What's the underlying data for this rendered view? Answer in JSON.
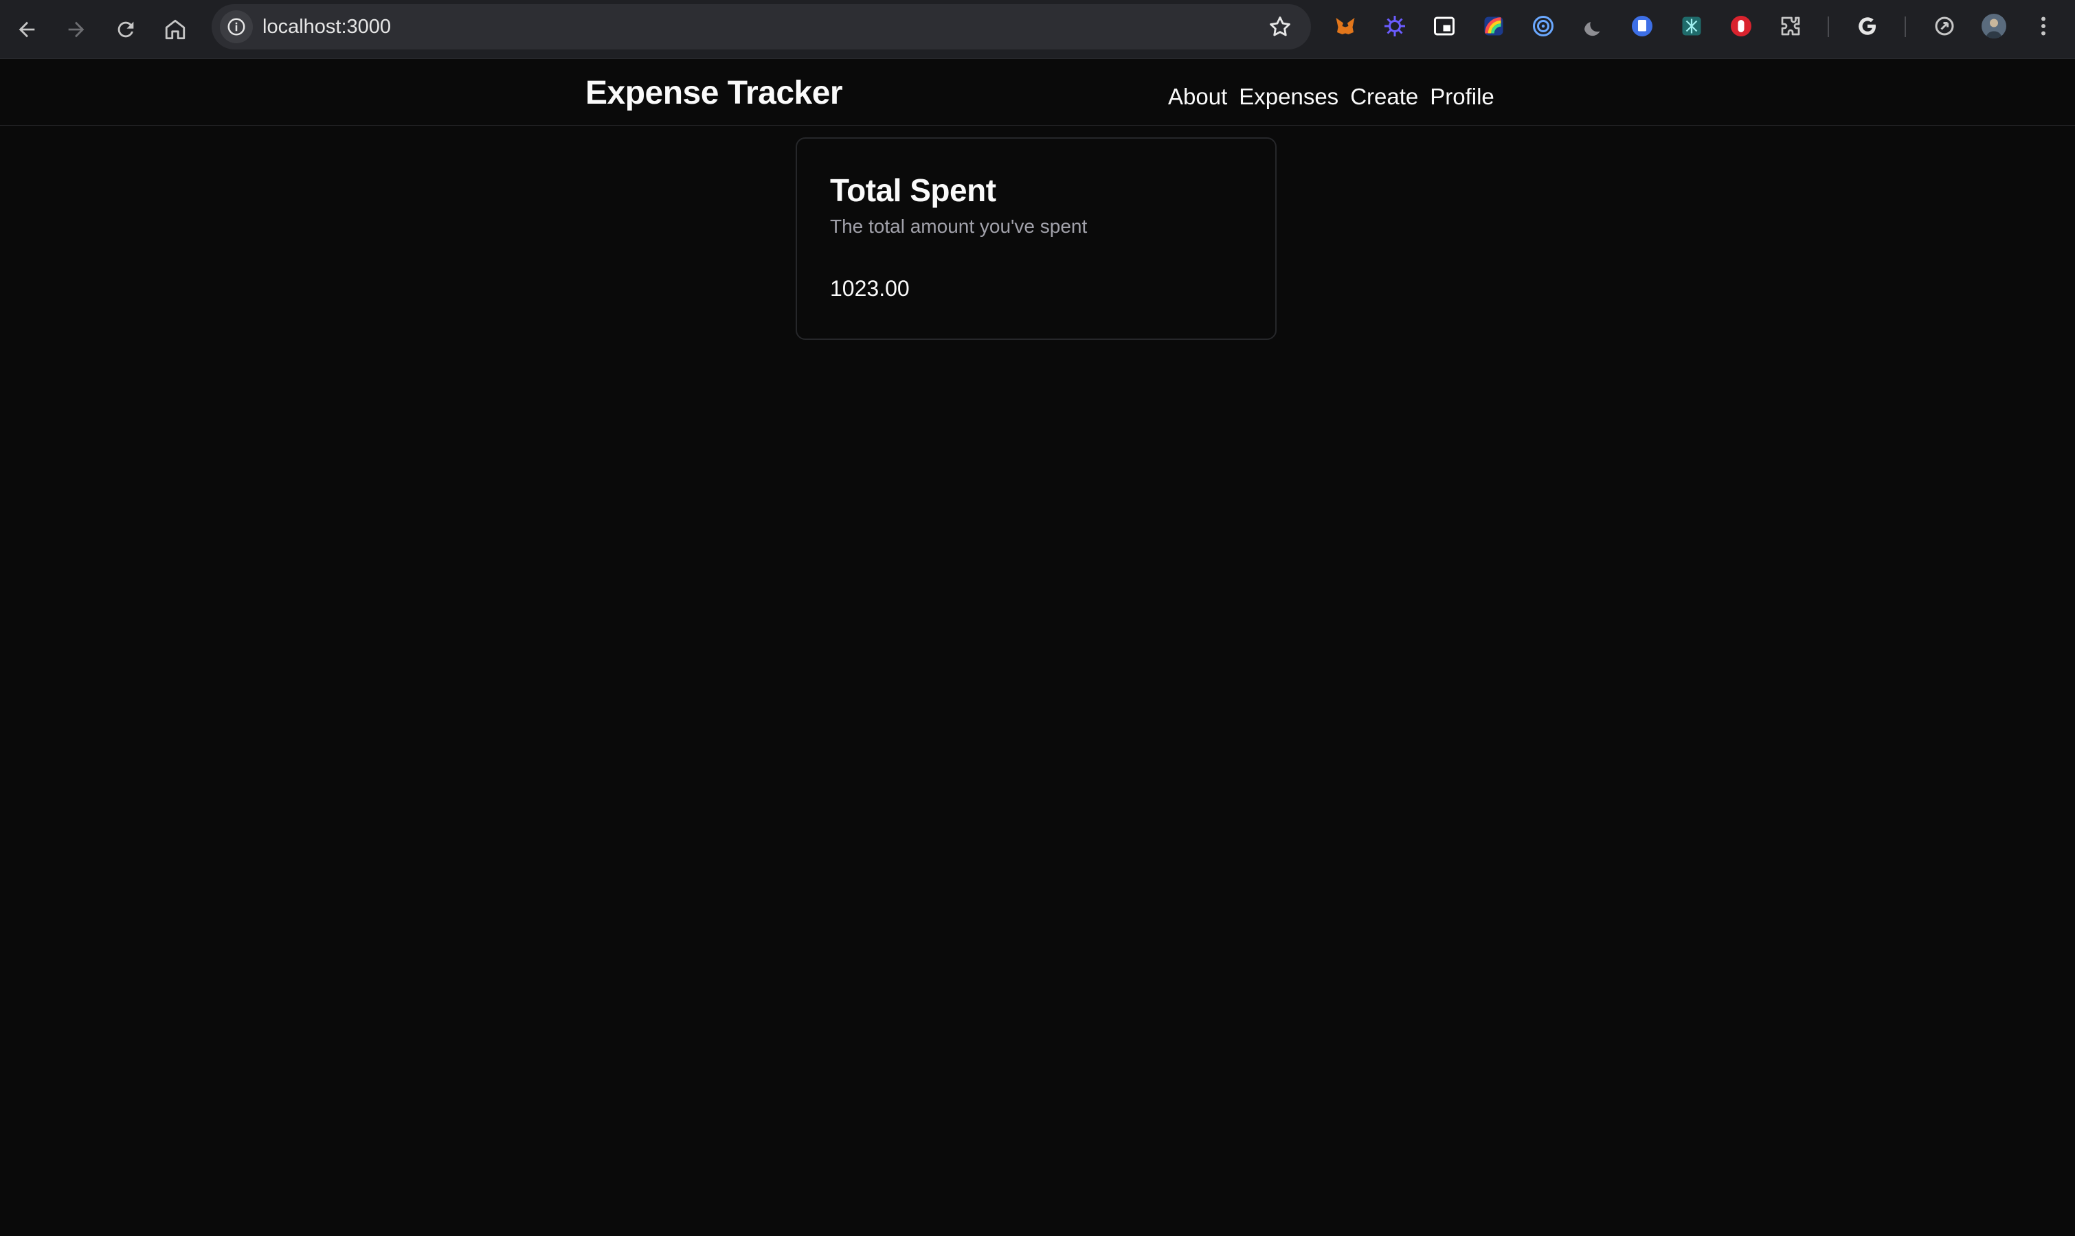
{
  "browser": {
    "url": "localhost:3000"
  },
  "header": {
    "title": "Expense Tracker",
    "nav": [
      "About",
      "Expenses",
      "Create",
      "Profile"
    ]
  },
  "card": {
    "title": "Total Spent",
    "description": "The total amount you've spent",
    "value": "1023.00"
  },
  "colors": {
    "background": "#0a0a0a",
    "text": "#fafafa",
    "muted_text": "#a1a1aa",
    "border": "#26272a",
    "browser_chrome": "#1f2024"
  },
  "icons": {
    "browser": [
      "back-arrow-icon",
      "forward-arrow-icon",
      "reload-icon",
      "home-icon",
      "site-info-icon",
      "bookmark-star-icon"
    ],
    "extensions": [
      "metamask-fox-icon",
      "puzzle-star-icon",
      "picture-in-picture-icon",
      "rainbow-icon",
      "target-icon",
      "moon-icon",
      "document-icon",
      "grammar-icon",
      "hand-stop-icon",
      "extensions-puzzle-icon",
      "google-g-icon",
      "sync-icon",
      "profile-avatar-icon",
      "more-vert-icon"
    ]
  }
}
